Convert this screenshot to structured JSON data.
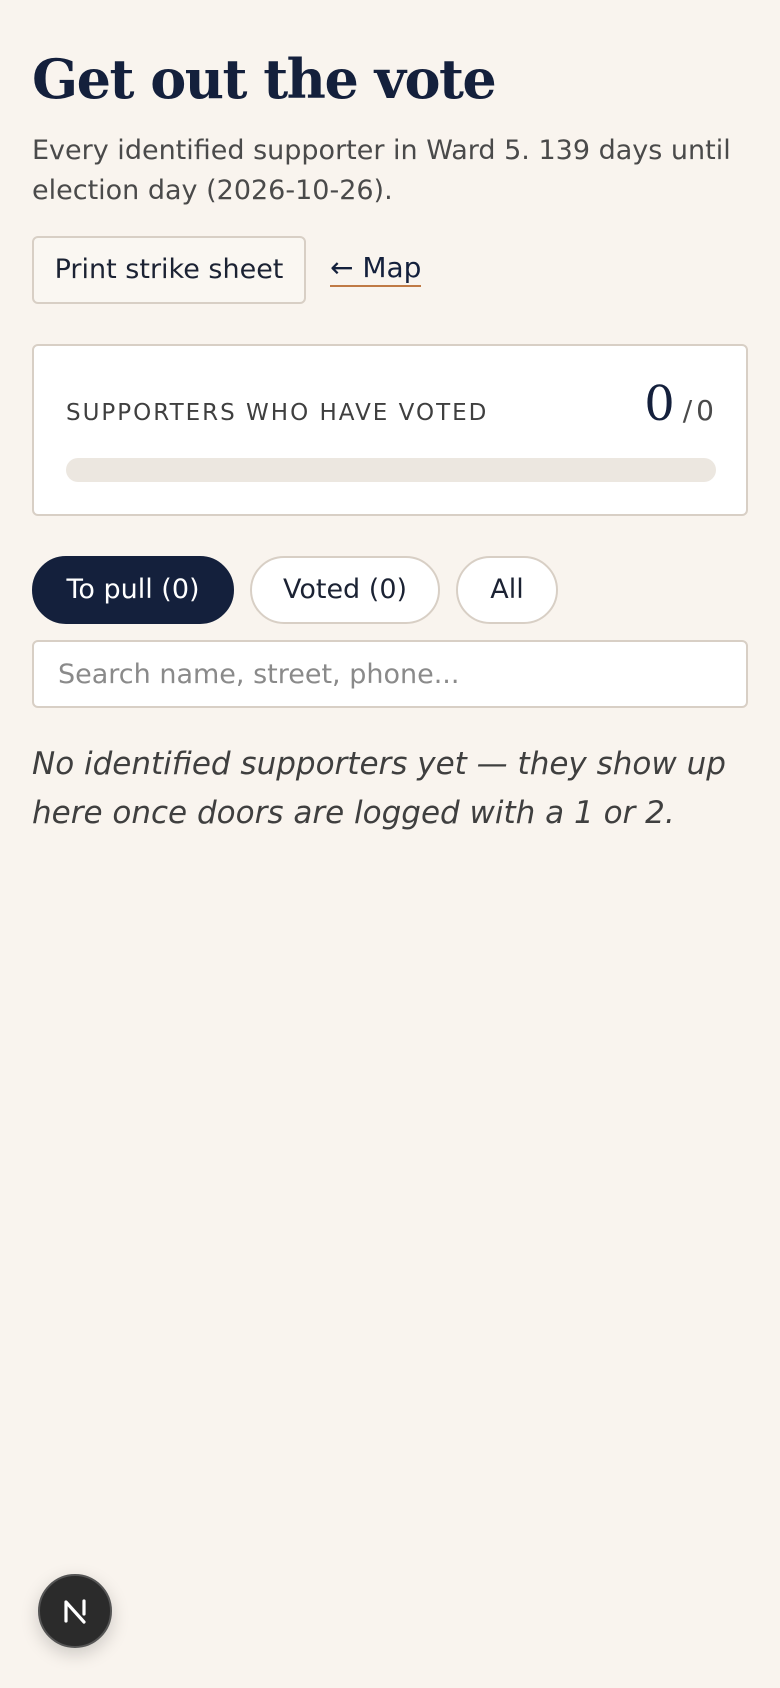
{
  "header": {
    "title": "Get out the vote",
    "subtitle": "Every identified supporter in Ward 5. 139 days until election day (2026-10-26)."
  },
  "actions": {
    "print_label": "Print strike sheet",
    "map_link_label": "← Map"
  },
  "progress_card": {
    "label": "SUPPORTERS WHO HAVE VOTED",
    "voted": "0",
    "separator": "/",
    "total": "0",
    "fraction_voted": 0
  },
  "filters": [
    {
      "label": "To pull (0)",
      "active": true
    },
    {
      "label": "Voted (0)",
      "active": false
    },
    {
      "label": "All",
      "active": false
    }
  ],
  "search": {
    "placeholder": "Search name, street, phone...",
    "value": ""
  },
  "empty_state": {
    "message": "No identified supporters yet — they show up here once doors are logged with a 1 or 2."
  },
  "devtools_badge": {
    "icon": "nextjs-logo-icon"
  },
  "colors": {
    "background": "#f9f4ee",
    "accent": "#14203c",
    "link_underline": "#c07a45",
    "border": "#d8cfc5"
  }
}
